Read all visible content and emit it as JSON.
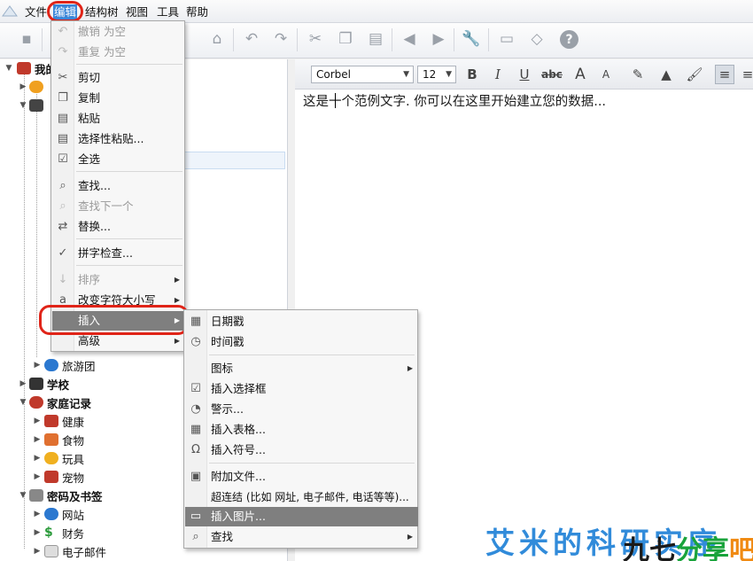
{
  "menubar": {
    "items": [
      "文件",
      "编辑",
      "结构树",
      "视图",
      "工具",
      "帮助"
    ],
    "active": "编辑"
  },
  "toolbar": {
    "icons": [
      "save-icon",
      "paste-icon",
      "find-icon",
      "undo-icon",
      "redo-icon",
      "cut-icon",
      "copy-icon",
      "paste-special-icon",
      "back-icon",
      "forward-icon",
      "tools-icon",
      "print-icon",
      "eraser-icon",
      "help-icon"
    ]
  },
  "tree": {
    "rows": [
      {
        "label": "我的",
        "bold": true,
        "icon_color": "#c0392b"
      },
      {
        "label": "",
        "bold": false,
        "icon_color": "#f0a020"
      },
      {
        "label": "旅游团",
        "bold": false,
        "icon_color": "#2b78d0"
      },
      {
        "label": "学校",
        "bold": true,
        "icon_color": "#333333"
      },
      {
        "label": "家庭记录",
        "bold": true,
        "icon_color": "#c0392b"
      },
      {
        "label": "健康",
        "bold": false,
        "icon_color": "#c0392b"
      },
      {
        "label": "食物",
        "bold": false,
        "icon_color": "#e07030"
      },
      {
        "label": "玩具",
        "bold": false,
        "icon_color": "#f0b020"
      },
      {
        "label": "宠物",
        "bold": false,
        "icon_color": "#c0392b"
      },
      {
        "label": "密码及书签",
        "bold": true,
        "icon_color": "#888888"
      },
      {
        "label": "网站",
        "bold": false,
        "icon_color": "#2b78d0"
      },
      {
        "label": "财务",
        "bold": false,
        "icon_color": "#2a9a3a"
      },
      {
        "label": "电子邮件",
        "bold": false,
        "icon_color": "#999999"
      }
    ]
  },
  "format_bar": {
    "font": "Corbel",
    "size": "12",
    "buttons": [
      "B",
      "I",
      "U",
      "abc",
      "A",
      "A"
    ]
  },
  "document": {
    "text": "这是一个范例文字. 你可以在这里开始建立您的数据..."
  },
  "edit_menu": {
    "items": [
      {
        "label": "撤销 为空",
        "disabled": true,
        "icon": "undo-icon",
        "glyph": "↶"
      },
      {
        "label": "重复 为空",
        "disabled": true,
        "icon": "redo-icon",
        "glyph": "↷"
      },
      {
        "sep": true
      },
      {
        "label": "剪切",
        "icon": "cut-icon",
        "glyph": "✂"
      },
      {
        "label": "复制",
        "icon": "copy-icon",
        "glyph": "❐"
      },
      {
        "label": "粘贴",
        "icon": "paste-icon",
        "glyph": "📋"
      },
      {
        "label": "选择性粘贴...",
        "icon": "paste-special-icon",
        "glyph": "📋"
      },
      {
        "label": "全选",
        "icon": "select-all-icon",
        "glyph": "☑"
      },
      {
        "sep": true
      },
      {
        "label": "查找...",
        "icon": "find-icon",
        "glyph": "🔍"
      },
      {
        "label": "查找下一个",
        "disabled": true,
        "icon": "find-next-icon",
        "glyph": "🔍"
      },
      {
        "label": "替换...",
        "icon": "replace-icon",
        "glyph": "⇄"
      },
      {
        "sep": true
      },
      {
        "label": "拼字检查...",
        "icon": "spellcheck-icon",
        "glyph": "✓"
      },
      {
        "sep": true
      },
      {
        "label": "排序",
        "disabled": true,
        "icon": "sort-icon",
        "glyph": "↓",
        "submenu": true
      },
      {
        "label": "改变字符大小写",
        "icon": "case-icon",
        "glyph": "a",
        "submenu": true
      },
      {
        "label": "插入",
        "highlight": true,
        "icon": "insert-icon",
        "glyph": "",
        "submenu": true
      },
      {
        "label": "高级",
        "icon": "advanced-icon",
        "glyph": "",
        "submenu": true
      }
    ]
  },
  "insert_menu": {
    "items": [
      {
        "label": "日期戳",
        "icon": "calendar-icon",
        "glyph": "▦"
      },
      {
        "label": "时间戳",
        "icon": "clock-icon",
        "glyph": "◷"
      },
      {
        "sep": true
      },
      {
        "label": "图标",
        "icon": "",
        "glyph": "",
        "submenu": true
      },
      {
        "label": "插入选择框",
        "icon": "checkbox-icon",
        "glyph": "☑"
      },
      {
        "label": "警示...",
        "icon": "alarm-icon",
        "glyph": "⏰"
      },
      {
        "label": "插入表格...",
        "icon": "table-icon",
        "glyph": "▦"
      },
      {
        "label": "插入符号...",
        "icon": "omega-icon",
        "glyph": "Ω"
      },
      {
        "sep": true
      },
      {
        "label": "附加文件...",
        "icon": "attach-icon",
        "glyph": "🖫"
      },
      {
        "label": "超连结 (比如 网址, 电子邮件, 电话等等)...",
        "icon": "",
        "glyph": ""
      },
      {
        "label": "插入图片...",
        "highlight": true,
        "icon": "image-icon",
        "glyph": "🖼"
      },
      {
        "label": "查找",
        "icon": "find-icon",
        "glyph": "⌕",
        "submenu": true
      }
    ]
  },
  "watermark": {
    "line1": "艾米的科研实序",
    "line2_a": "九七",
    "line2_b": "分享",
    "line2_c": "吧"
  },
  "colors": {
    "highlight_ring": "#e02418",
    "menu_hover": "#7f7f7f",
    "menubar_active": "#3a86d8"
  }
}
